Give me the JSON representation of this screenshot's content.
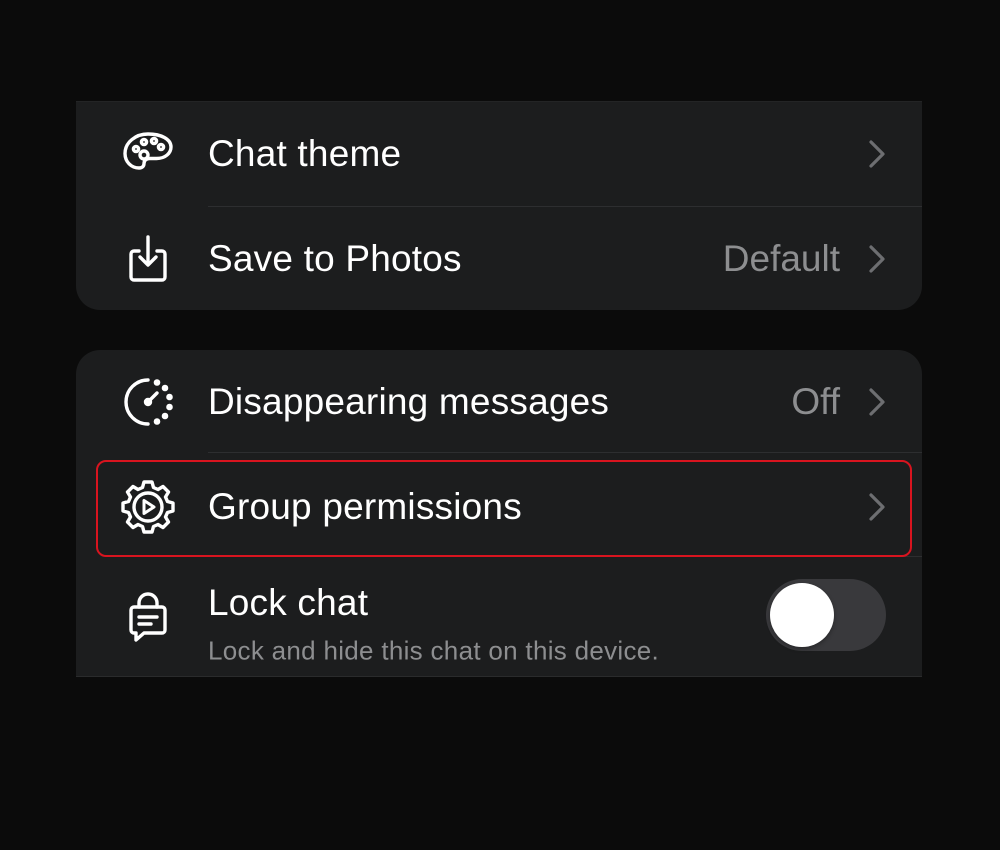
{
  "colors": {
    "background": "#0b0b0b",
    "card": "#1c1d1e",
    "text_primary": "#ffffff",
    "text_secondary": "#8d8e90",
    "highlight_border": "#d8141f",
    "toggle_off": "#39393c"
  },
  "group_1": {
    "items": [
      {
        "icon": "palette-icon",
        "label": "Chat theme",
        "value": ""
      },
      {
        "icon": "save-download-icon",
        "label": "Save to Photos",
        "value": "Default"
      }
    ]
  },
  "group_2": {
    "items": [
      {
        "icon": "timer-icon",
        "label": "Disappearing messages",
        "value": "Off"
      },
      {
        "icon": "gear-play-icon",
        "label": "Group permissions",
        "value": "",
        "highlighted": true
      },
      {
        "icon": "lock-chat-icon",
        "label": "Lock chat",
        "subtitle": "Lock and hide this chat on this device.",
        "toggle": false
      }
    ]
  }
}
